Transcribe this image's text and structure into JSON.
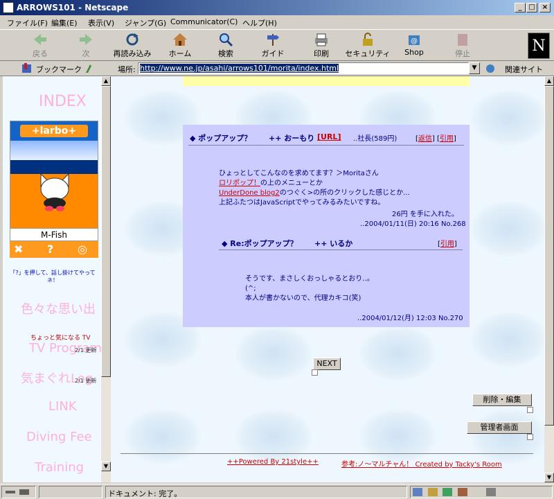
{
  "window": {
    "title": "ARROWS101 - Netscape"
  },
  "menu": [
    "ファイル(F)",
    "編集(E)",
    "表示(V)",
    "ジャンプ(G)",
    "Communicator(C)",
    "ヘルプ(H)"
  ],
  "toolbar": {
    "back": "戻る",
    "forward": "次",
    "reload": "再読み込み",
    "home": "ホーム",
    "search": "検索",
    "guide": "ガイド",
    "print": "印刷",
    "security": "セキュリティ",
    "shop": "Shop",
    "stop": "停止",
    "logo": "N"
  },
  "location": {
    "bookmarks": "ブックマーク",
    "label": "場所:",
    "url": "http://www.ne.jp/asahi/arrows101/morita/index.html",
    "related": "関連サイト"
  },
  "sidebar": {
    "index": "INDEX",
    "banner": "+larbo+",
    "card_caption": "M-Fish",
    "note": "「?」を押して、話し掛けてやってネ！",
    "links": [
      "色々な思い出",
      "TV Program",
      "気まぐれLog",
      "LINK",
      "Diving Fee",
      "Training"
    ],
    "tv_notice": "ちょっと気になる TV",
    "update1": "2/1 更新",
    "update2": "2/1 更新"
  },
  "post": {
    "title": "◆ ポップアップ？",
    "author_prefix": "++ おーもり",
    "url_link": "[URL]",
    "author_info": "..社長(589円)",
    "reply": "返信",
    "quote": "引用",
    "lines": [
      "ひょっとしてこんなのを求めてます？＞Moritaさん",
      "ロリポップ！",
      "の上のメニューとか",
      "UnderDone blog2",
      "のつぐく>の所のクリックした感じとか...",
      "上記ふたつはJavaScriptでやってみるみたいですね。"
    ],
    "bonus": "26円 を手に入れた。",
    "meta": "..2004/01/11(日) 20:16 No.268"
  },
  "reply_post": {
    "title": "◆ Re:ポップアップ？",
    "author": "++ いるか",
    "quote": "引用",
    "lines": [
      "そうです、まさしくおっしゃるとおり‥。",
      "(^;",
      "本人が書かないので、代理カキコ(笑)"
    ],
    "meta": "..2004/01/12(月) 12:03 No.270"
  },
  "next_button": "NEXT",
  "delete_edit_button": "削除・編集",
  "admin_button": "管理者画面",
  "footer": {
    "powered": "++Powered By 21style++",
    "ref": "参考:ノ～マルチャん！ Created by Tacky's Room"
  },
  "status": {
    "text": "ドキュメント: 完了。"
  }
}
